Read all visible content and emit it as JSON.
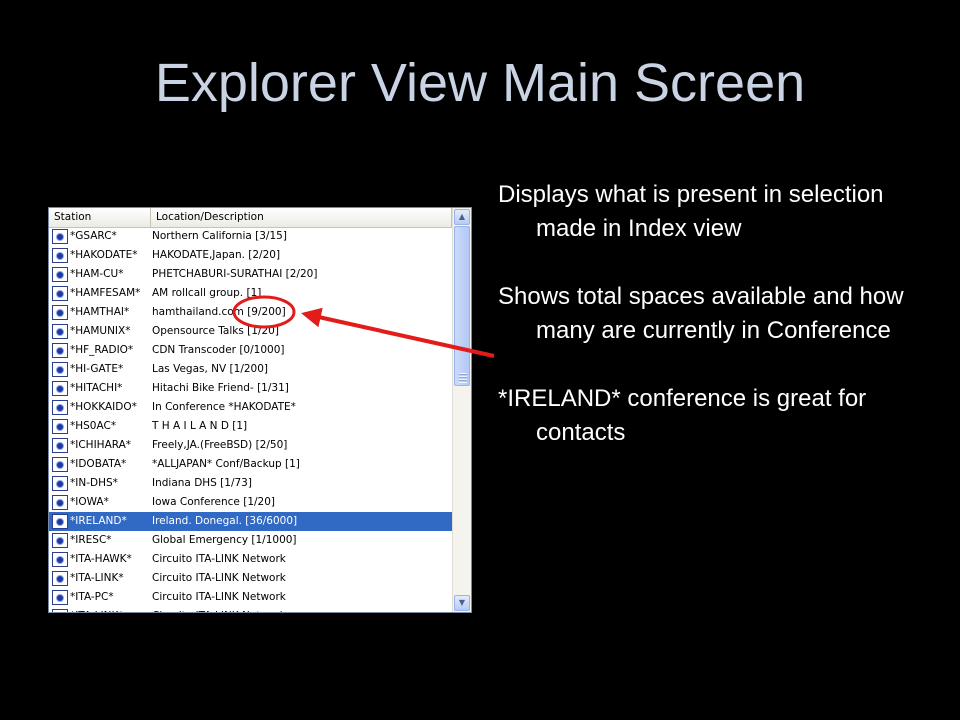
{
  "slide": {
    "title": "Explorer View Main Screen",
    "bullets": [
      "Displays what is present in selection made in Index view",
      "Shows total spaces available and how many are currently in Conference",
      "*IRELAND* conference is great for contacts"
    ]
  },
  "explorer": {
    "columns": [
      "Station",
      "Location/Description"
    ],
    "selected_station": "*IRELAND*",
    "scroll_position_fraction": 0.05,
    "rows": [
      {
        "station": "*GSARC*",
        "location": "Northern California  [3/15]"
      },
      {
        "station": "*HAKODATE*",
        "location": "HAKODATE,Japan. [2/20]"
      },
      {
        "station": "*HAM-CU*",
        "location": "PHETCHABURI-SURATHAI [2/20]"
      },
      {
        "station": "*HAMFESAM*",
        "location": "AM rollcall group. [1]"
      },
      {
        "station": "*HAMTHAI*",
        "location": "hamthailand.com [9/200]"
      },
      {
        "station": "*HAMUNIX*",
        "location": "Opensource Talks [1/20]"
      },
      {
        "station": "*HF_RADIO*",
        "location": "CDN Transcoder [0/1000]"
      },
      {
        "station": "*HI-GATE*",
        "location": "Las Vegas, NV [1/200]"
      },
      {
        "station": "*HITACHI*",
        "location": "Hitachi Bike Friend- [1/31]"
      },
      {
        "station": "*HOKKAIDO*",
        "location": "In Conference *HAKODATE*"
      },
      {
        "station": "*HS0AC*",
        "location": "T H A I L A N D [1]"
      },
      {
        "station": "*ICHIHARA*",
        "location": "Freely,JA.(FreeBSD) [2/50]"
      },
      {
        "station": "*IDOBATA*",
        "location": "*ALLJAPAN* Conf/Backup [1]"
      },
      {
        "station": "*IN-DHS*",
        "location": "Indiana DHS [1/73]"
      },
      {
        "station": "*IOWA*",
        "location": "Iowa Conference [1/20]"
      },
      {
        "station": "*IRELAND*",
        "location": "Ireland. Donegal. [36/6000]"
      },
      {
        "station": "*IRESC*",
        "location": "Global Emergency [1/1000]"
      },
      {
        "station": "*ITA-HAWK*",
        "location": "Circuito ITA-LINK Network"
      },
      {
        "station": "*ITA-LINK*",
        "location": "Circuito ITA-LINK Network"
      },
      {
        "station": "*ITA-PC*",
        "location": "Circuito ITA-LINK Network"
      },
      {
        "station": "*ITA-LINK*",
        "location": "Circuito ITA-LINK Network"
      }
    ]
  },
  "colors": {
    "background": "#000000",
    "title": "#c9d3e3",
    "selection": "#316ac5",
    "callout": "#e21b1b"
  }
}
